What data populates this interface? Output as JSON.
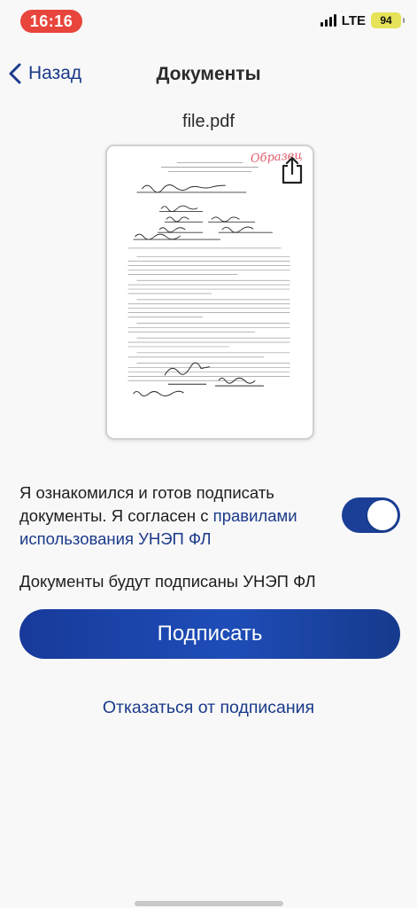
{
  "status_bar": {
    "time": "16:16",
    "network": "LTE",
    "battery": "94"
  },
  "nav": {
    "back_label": "Назад",
    "title": "Документы"
  },
  "file": {
    "name": "file.pdf"
  },
  "preview": {
    "stamp_text": "Образец"
  },
  "consent": {
    "text": "Я ознакомился и готов подписать документы. Я согласен с ",
    "link": "правилами использования УНЭП ФЛ",
    "toggle_on": true
  },
  "sign_note": "Документы будут подписаны УНЭП ФЛ",
  "actions": {
    "sign_label": "Подписать",
    "decline_label": "Отказаться от подписания"
  },
  "colors": {
    "accent": "#1b3f97",
    "link": "#1a3a8a",
    "time_pill": "#e8453c"
  }
}
